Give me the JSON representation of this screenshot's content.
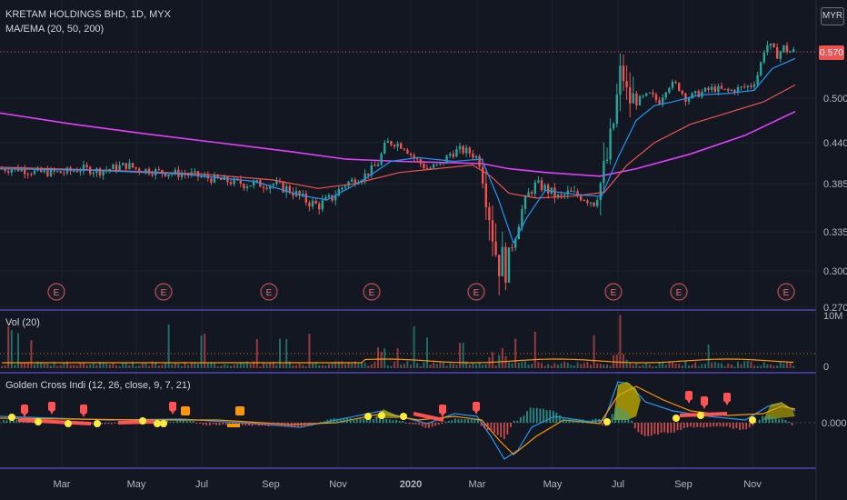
{
  "header": {
    "title": "KRETAM HOLDINGS BHD, 1D, MYX",
    "ma_label": "MA/EMA (20, 50, 200)",
    "vol_label": "Vol (20)",
    "osc_label": "Golden Cross Indi (12, 26, close, 9, 7, 21)"
  },
  "currency": "MYR",
  "last_price_tag": "0.570",
  "earnings_marker": "E",
  "colors": {
    "background": "#131722",
    "up": "#26a69a",
    "down": "#ef5350",
    "ma20": "#2196f3",
    "ma50": "#ef5350",
    "ma200": "#e040fb",
    "volume_ma": "#ff9800",
    "divider": "#5b4fd8",
    "dot": "#ffeb3b",
    "marker": "#ff5252",
    "orange": "#ff9800",
    "golden_fill": "#c8b400"
  },
  "chart_data": [
    {
      "type": "candlestick",
      "title": "KRETAM HOLDINGS BHD, 1D, MYX",
      "y_ticks": [
        "0.570",
        "0.500",
        "0.440",
        "0.385",
        "0.335",
        "0.300",
        "0.270"
      ],
      "x_ticks": [
        "Mar",
        "May",
        "Jul",
        "Sep",
        "Nov",
        "2020",
        "Mar",
        "May",
        "Jul",
        "Sep",
        "Nov"
      ],
      "ylim": [
        0.27,
        0.6
      ],
      "last_price": 0.57,
      "price_path": [
        [
          0,
          0.405
        ],
        [
          20,
          0.405
        ],
        [
          40,
          0.4
        ],
        [
          70,
          0.4
        ],
        [
          90,
          0.405
        ],
        [
          110,
          0.402
        ],
        [
          140,
          0.41
        ],
        [
          150,
          0.405
        ],
        [
          180,
          0.4
        ],
        [
          210,
          0.397
        ],
        [
          240,
          0.39
        ],
        [
          270,
          0.385
        ],
        [
          300,
          0.385
        ],
        [
          320,
          0.378
        ],
        [
          335,
          0.368
        ],
        [
          350,
          0.362
        ],
        [
          365,
          0.37
        ],
        [
          380,
          0.385
        ],
        [
          400,
          0.395
        ],
        [
          415,
          0.41
        ],
        [
          425,
          0.44
        ],
        [
          435,
          0.44
        ],
        [
          445,
          0.435
        ],
        [
          455,
          0.42
        ],
        [
          470,
          0.405
        ],
        [
          485,
          0.41
        ],
        [
          495,
          0.425
        ],
        [
          505,
          0.43
        ],
        [
          515,
          0.428
        ],
        [
          525,
          0.42
        ],
        [
          532,
          0.4
        ],
        [
          538,
          0.36
        ],
        [
          545,
          0.32
        ],
        [
          552,
          0.305
        ],
        [
          560,
          0.315
        ],
        [
          568,
          0.335
        ],
        [
          575,
          0.36
        ],
        [
          582,
          0.375
        ],
        [
          590,
          0.385
        ],
        [
          600,
          0.38
        ],
        [
          615,
          0.37
        ],
        [
          625,
          0.375
        ],
        [
          640,
          0.372
        ],
        [
          655,
          0.365
        ],
        [
          665,
          0.4
        ],
        [
          672,
          0.44
        ],
        [
          678,
          0.49
        ],
        [
          684,
          0.55
        ],
        [
          690,
          0.5
        ],
        [
          700,
          0.495
        ],
        [
          715,
          0.505
        ],
        [
          725,
          0.495
        ],
        [
          735,
          0.52
        ],
        [
          745,
          0.52
        ],
        [
          755,
          0.5
        ],
        [
          765,
          0.505
        ],
        [
          775,
          0.51
        ],
        [
          785,
          0.515
        ],
        [
          800,
          0.51
        ],
        [
          815,
          0.515
        ],
        [
          828,
          0.52
        ],
        [
          835,
          0.54
        ],
        [
          842,
          0.58
        ],
        [
          848,
          0.575
        ],
        [
          855,
          0.565
        ],
        [
          862,
          0.575
        ],
        [
          870,
          0.57
        ],
        [
          875,
          0.57
        ]
      ],
      "series": [
        {
          "name": "MA 20",
          "values": [
            [
              0,
              0.405
            ],
            [
              100,
              0.403
            ],
            [
              200,
              0.398
            ],
            [
              280,
              0.388
            ],
            [
              330,
              0.373
            ],
            [
              360,
              0.368
            ],
            [
              400,
              0.39
            ],
            [
              430,
              0.415
            ],
            [
              460,
              0.42
            ],
            [
              500,
              0.415
            ],
            [
              530,
              0.418
            ],
            [
              548,
              0.37
            ],
            [
              565,
              0.325
            ],
            [
              580,
              0.35
            ],
            [
              600,
              0.378
            ],
            [
              640,
              0.373
            ],
            [
              662,
              0.372
            ],
            [
              680,
              0.42
            ],
            [
              700,
              0.47
            ],
            [
              720,
              0.49
            ],
            [
              740,
              0.495
            ],
            [
              770,
              0.505
            ],
            [
              800,
              0.507
            ],
            [
              830,
              0.512
            ],
            [
              850,
              0.545
            ],
            [
              875,
              0.56
            ]
          ]
        },
        {
          "name": "MA 50",
          "values": [
            [
              0,
              0.407
            ],
            [
              120,
              0.403
            ],
            [
              220,
              0.398
            ],
            [
              300,
              0.39
            ],
            [
              350,
              0.38
            ],
            [
              390,
              0.385
            ],
            [
              440,
              0.4
            ],
            [
              480,
              0.405
            ],
            [
              520,
              0.41
            ],
            [
              540,
              0.395
            ],
            [
              560,
              0.375
            ],
            [
              590,
              0.37
            ],
            [
              630,
              0.372
            ],
            [
              665,
              0.376
            ],
            [
              690,
              0.41
            ],
            [
              720,
              0.44
            ],
            [
              760,
              0.465
            ],
            [
              800,
              0.48
            ],
            [
              840,
              0.495
            ],
            [
              875,
              0.52
            ]
          ]
        },
        {
          "name": "MA 200",
          "values": [
            [
              0,
              0.48
            ],
            [
              80,
              0.465
            ],
            [
              160,
              0.452
            ],
            [
              240,
              0.44
            ],
            [
              320,
              0.428
            ],
            [
              380,
              0.418
            ],
            [
              440,
              0.415
            ],
            [
              500,
              0.413
            ],
            [
              530,
              0.412
            ],
            [
              560,
              0.405
            ],
            [
              600,
              0.4
            ],
            [
              660,
              0.395
            ],
            [
              700,
              0.405
            ],
            [
              760,
              0.425
            ],
            [
              820,
              0.45
            ],
            [
              875,
              0.482
            ]
          ]
        }
      ],
      "earnings_x": [
        62,
        180,
        296,
        409,
        524,
        675,
        747,
        865
      ]
    },
    {
      "type": "bar",
      "title": "Vol (20)",
      "y_ticks": [
        "10M",
        "0"
      ],
      "ylim": [
        0,
        10
      ]
    },
    {
      "type": "area",
      "title": "Golden Cross Indi (12, 26, close, 9, 7, 21)",
      "y_ticks": [
        "0.000"
      ]
    }
  ]
}
